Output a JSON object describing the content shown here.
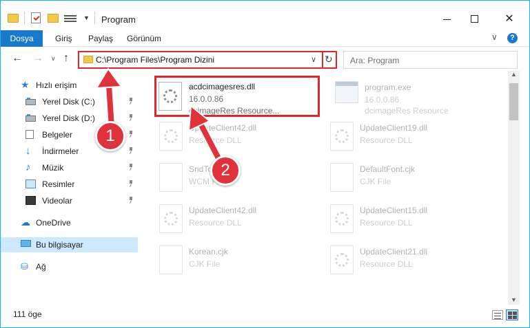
{
  "window": {
    "title": "Program",
    "colors": {
      "accent": "#1979ca",
      "border": "#17b3e8",
      "highlight": "#e0252b",
      "selection": "#cde8ff"
    }
  },
  "quick_access_toolbar": {
    "icons": [
      "folder-icon",
      "properties-icon",
      "new-folder-icon",
      "view-icon",
      "dropdown-icon"
    ]
  },
  "ribbon": {
    "file_tab": "Dosya",
    "tabs": [
      "Giriş",
      "Paylaş",
      "Görünüm"
    ],
    "help_label": "?"
  },
  "navigation": {
    "address": "C:\\Program Files\\Program Dizini",
    "search_placeholder": "Ara: Program"
  },
  "sidebar": {
    "items": [
      {
        "label": "Hızlı erişim",
        "icon": "star-icon"
      },
      {
        "label": "Yerel Disk (C:)",
        "icon": "disk-icon"
      },
      {
        "label": "Yerel Disk (D:)",
        "icon": "disk-icon"
      },
      {
        "label": "Belgeler",
        "icon": "documents-icon"
      },
      {
        "label": "İndirmeler",
        "icon": "downloads-icon"
      },
      {
        "label": "Müzik",
        "icon": "music-icon"
      },
      {
        "label": "Resimler",
        "icon": "pictures-icon"
      },
      {
        "label": "Videolar",
        "icon": "videos-icon"
      },
      {
        "label": "OneDrive",
        "icon": "cloud-icon"
      },
      {
        "label": "Bu bilgisayar",
        "icon": "computer-icon"
      },
      {
        "label": "Ağ",
        "icon": "network-icon"
      }
    ]
  },
  "files": [
    {
      "name": "acdcimagesres.dll",
      "line2": "16.0.0.86",
      "line3": "dcimageRes Resource..."
    },
    {
      "name": "program.exe",
      "line2": "16.0.0.86",
      "line3": "dcimageRes Resource"
    },
    {
      "name": "UpdateClient42.dll",
      "line2": "Resource DLL",
      "line3": ""
    },
    {
      "name": "UpdateClient19.dll",
      "line2": "Resource DLL",
      "line3": ""
    },
    {
      "name": "SndTo...wcm",
      "line2": "WCM File",
      "line3": ""
    },
    {
      "name": "DefaultFont.cjk",
      "line2": "CJK File",
      "line3": ""
    },
    {
      "name": "UpdateClient42.dll",
      "line2": "Resource DLL",
      "line3": ""
    },
    {
      "name": "UpdateClient15.dll",
      "line2": "Resource DLL",
      "line3": ""
    },
    {
      "name": "Korean.cjk",
      "line2": "CJK File",
      "line3": ""
    },
    {
      "name": "UpdateClient21.dll",
      "line2": "Resource DLL",
      "line3": ""
    }
  ],
  "status": {
    "item_count": "111 öge"
  },
  "annotations": {
    "badge_1": "1",
    "badge_2": "2"
  }
}
